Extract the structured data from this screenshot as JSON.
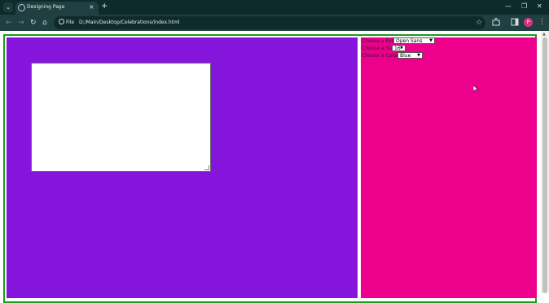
{
  "browser": {
    "tab_title": "Designing Page",
    "tab_close": "×",
    "new_tab": "+",
    "url_chip": "File",
    "url": "D:/Main/Desktop/Celebrations/index.html",
    "profile_initial": "P",
    "icons": [
      "tab-search-icon",
      "globe-icon",
      "close-icon",
      "plus-icon",
      "back-icon",
      "forward-icon",
      "reload-icon",
      "home-icon",
      "info-icon",
      "star-icon",
      "extensions-icon",
      "sidepanel-icon",
      "menu-icon"
    ],
    "window_controls": {
      "minimize": "—",
      "restore": "❐",
      "close": "✕"
    }
  },
  "page": {
    "colors": {
      "frame": "#1c9a1c",
      "left_panel": "#8514dc",
      "right_panel": "#ec008c",
      "textbox": "#ffffff"
    },
    "controls": [
      {
        "label": "Choose a Font:",
        "value": "Open Sans"
      },
      {
        "label": "Choose a Size:",
        "value": "16"
      },
      {
        "label": "Choose a Color:",
        "value": "Blue"
      }
    ]
  }
}
